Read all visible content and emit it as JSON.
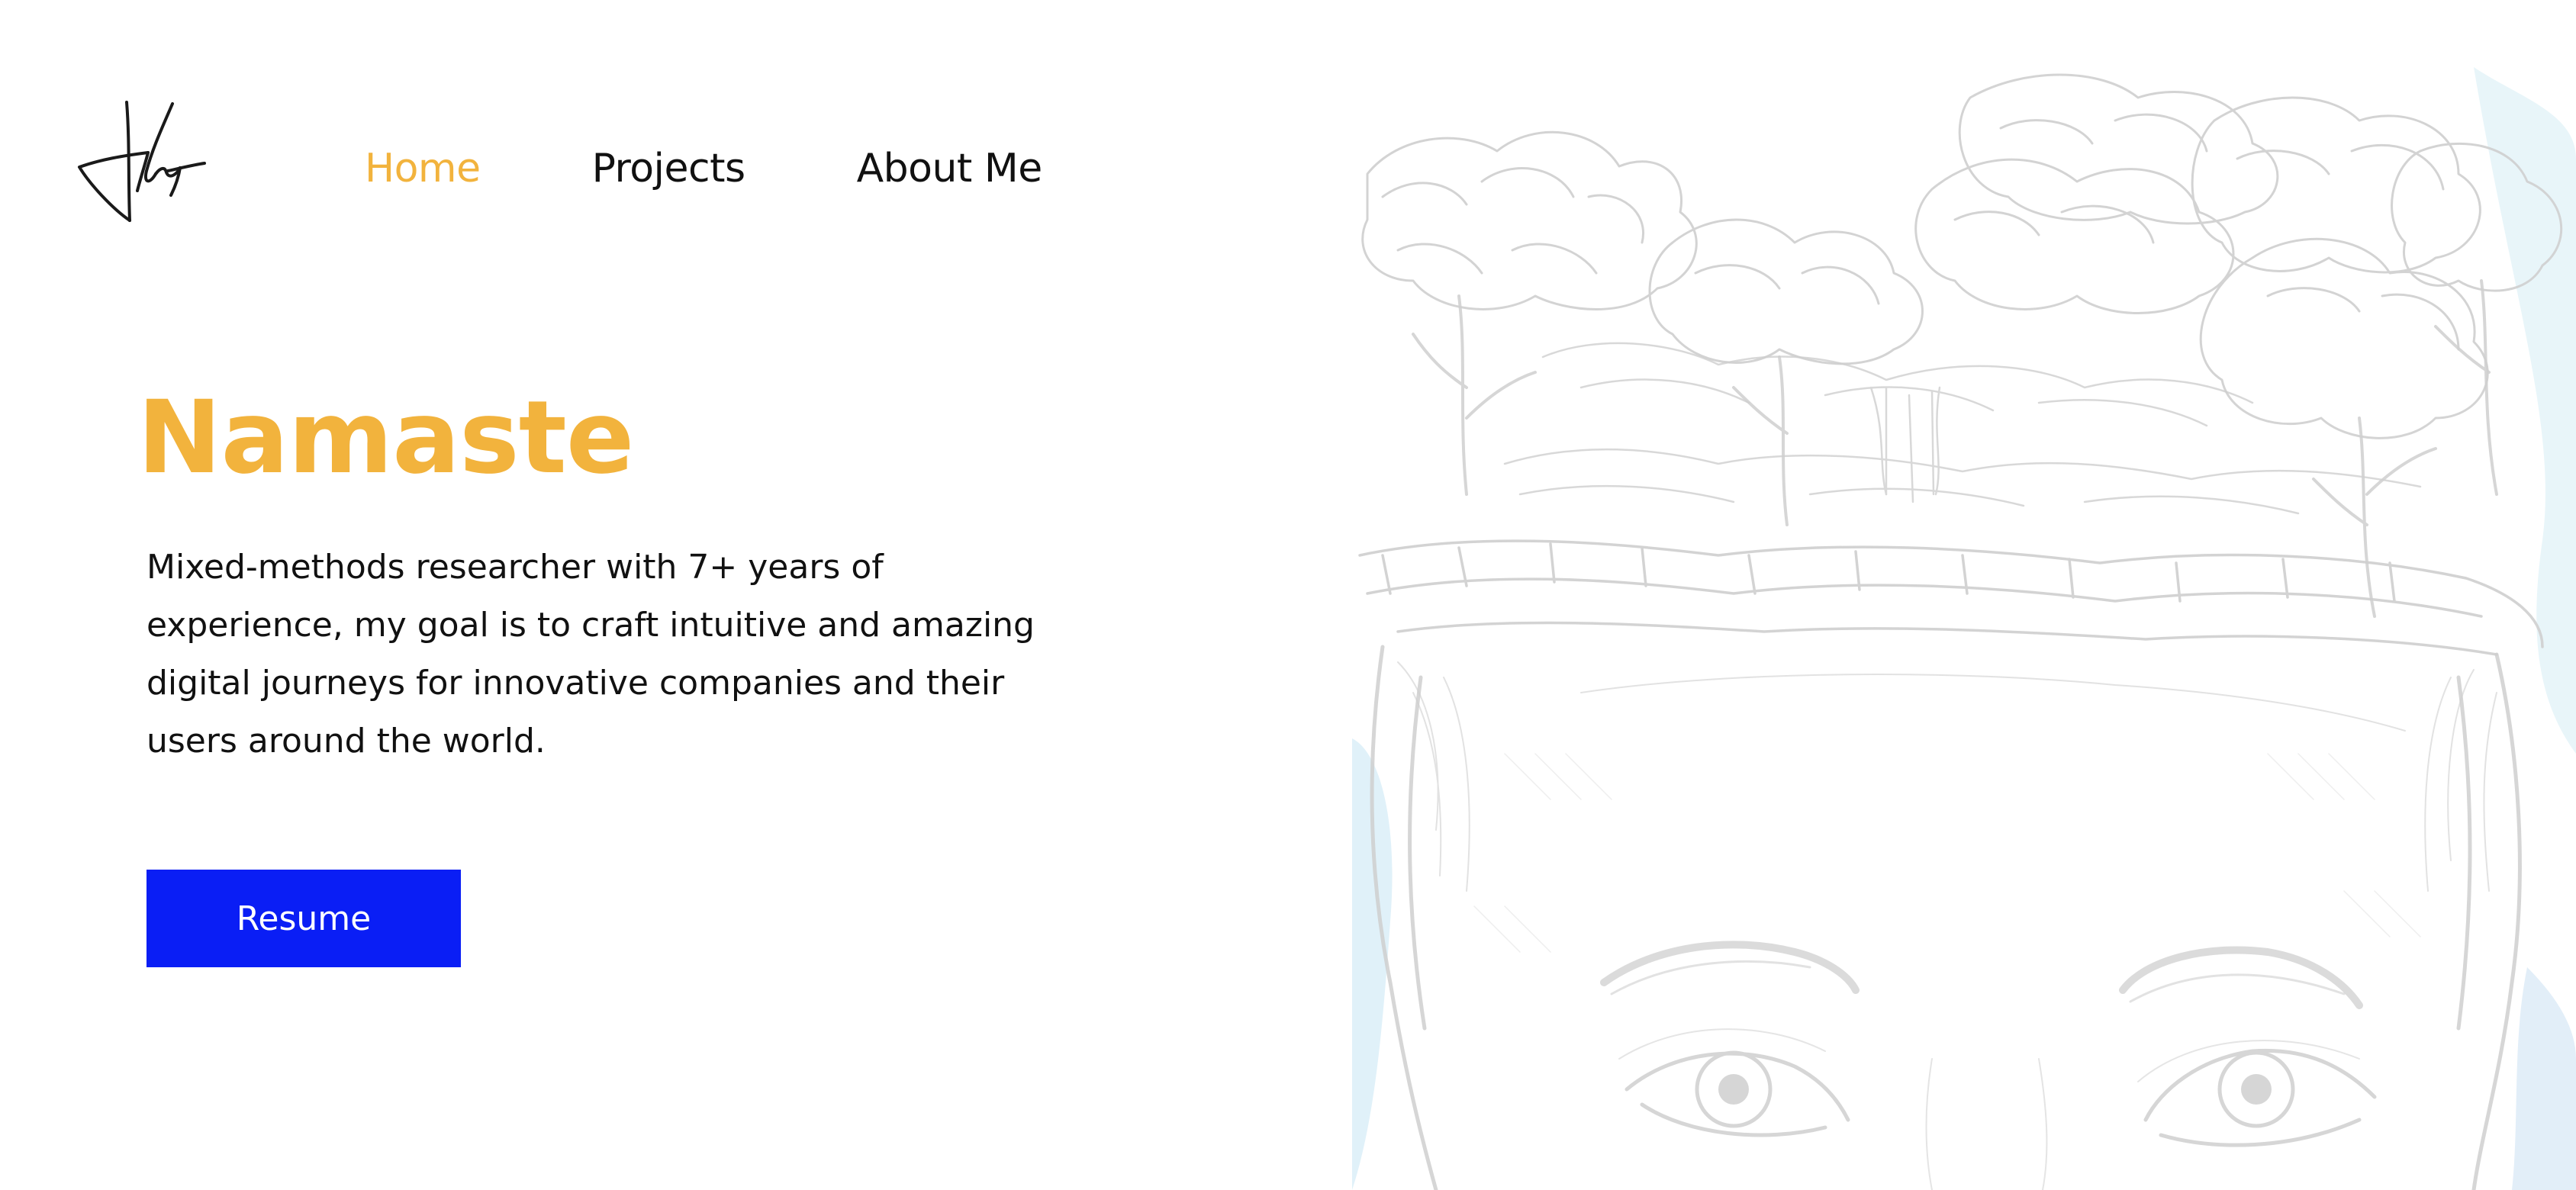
{
  "brand": {
    "logo_icon": "signature-logo-icon",
    "ink_color": "#1a1a1a"
  },
  "nav": {
    "items": [
      {
        "label": "Home",
        "active": true
      },
      {
        "label": "Projects",
        "active": false
      },
      {
        "label": "About Me",
        "active": false
      }
    ],
    "active_color": "#f2b33d"
  },
  "hero": {
    "headline": "Namaste",
    "headline_color": "#f2b33d",
    "intro_lines": [
      "Mixed-methods researcher with 7+ years of",
      "experience, my goal is to craft intuitive and amazing",
      "digital journeys for innovative companies and their",
      "users around the world."
    ],
    "cta_label": "Resume",
    "cta_color": "#0a1ef5"
  },
  "illustration": {
    "icon": "pencil-sketch-portrait-illustration",
    "style": "faded pencil sketch of a face with a forest growing from the head",
    "sketch_color": "#cfcfcf",
    "accent_wash_color": "#d8eef7"
  }
}
